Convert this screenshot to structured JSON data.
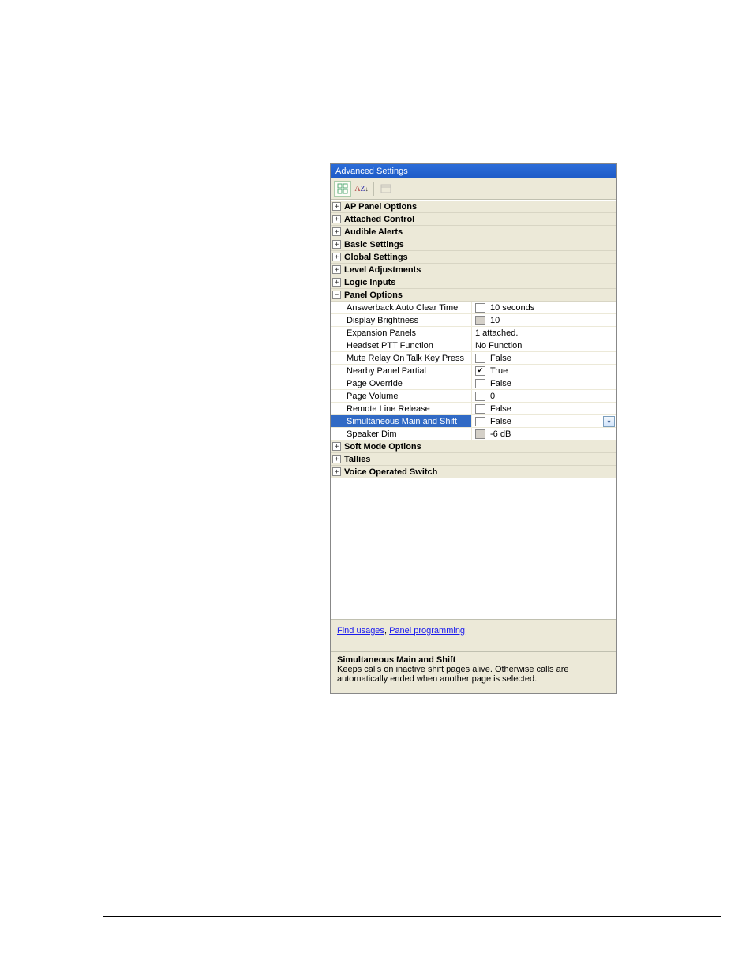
{
  "window": {
    "title": "Advanced Settings"
  },
  "categories": [
    {
      "label": "AP Panel Options",
      "expanded": false
    },
    {
      "label": "Attached Control",
      "expanded": false
    },
    {
      "label": "Audible Alerts",
      "expanded": false
    },
    {
      "label": "Basic Settings",
      "expanded": false
    },
    {
      "label": "Global Settings",
      "expanded": false
    },
    {
      "label": "Level Adjustments",
      "expanded": false
    },
    {
      "label": "Logic Inputs",
      "expanded": false
    },
    {
      "label": "Panel Options",
      "expanded": true
    },
    {
      "label": "Soft Mode Options",
      "expanded": false
    },
    {
      "label": "Tallies",
      "expanded": false
    },
    {
      "label": "Voice Operated Switch",
      "expanded": false
    }
  ],
  "panel_options": [
    {
      "name": "Answerback Auto Clear Time",
      "value": "10 seconds",
      "ctl": "box"
    },
    {
      "name": "Display Brightness",
      "value": "10",
      "ctl": "graybox"
    },
    {
      "name": "Expansion Panels",
      "value": "1 attached.",
      "ctl": "none"
    },
    {
      "name": "Headset PTT Function",
      "value": "No Function",
      "ctl": "none"
    },
    {
      "name": "Mute Relay On Talk Key Press",
      "value": "False",
      "ctl": "check_off"
    },
    {
      "name": "Nearby Panel Partial",
      "value": "True",
      "ctl": "check_on"
    },
    {
      "name": "Page Override",
      "value": "False",
      "ctl": "check_off"
    },
    {
      "name": "Page Volume",
      "value": "0",
      "ctl": "box"
    },
    {
      "name": "Remote Line Release",
      "value": "False",
      "ctl": "check_off"
    },
    {
      "name": "Simultaneous Main and Shift",
      "value": "False",
      "ctl": "check_off",
      "selected": true,
      "dropdown": true
    },
    {
      "name": "Speaker Dim",
      "value": "-6 dB",
      "ctl": "graybox"
    }
  ],
  "links": {
    "find_usages": "Find usages",
    "sep": ", ",
    "panel_programming": "Panel programming"
  },
  "description": {
    "title": "Simultaneous Main and Shift",
    "body": "Keeps calls on inactive shift pages alive. Otherwise calls are automatically ended when another page is selected."
  }
}
